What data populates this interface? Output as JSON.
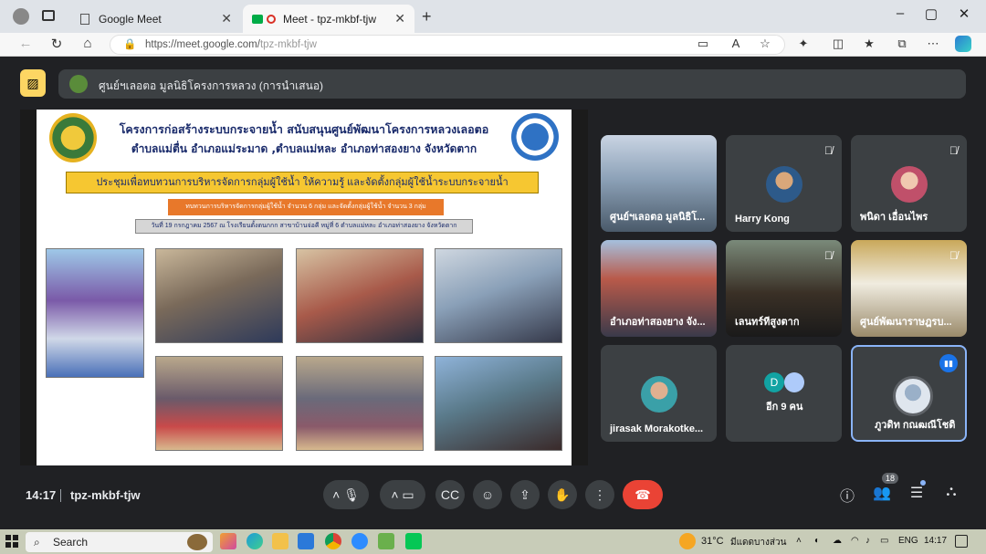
{
  "browser": {
    "tabs": [
      {
        "title": "Google Meet"
      },
      {
        "title": "Meet - tpz-mkbf-tjw"
      }
    ],
    "url_prefix": "https://meet.google.com/",
    "url_path": "tpz-mkbf-tjw"
  },
  "meet": {
    "presenter_banner": "ศูนย์ฯเลอตอ มูลนิธิโครงการหลวง (การนำเสนอ)",
    "slide": {
      "title_line1": "โครงการก่อสร้างระบบกระจายน้ำ สนับสนุนศูนย์พัฒนาโครงการหลวงเลอตอ",
      "title_line2": "ตำบลแม่ตื่น อำเภอแม่ระมาด ,ตำบลแม่หละ อำเภอท่าสองยาง จังหวัดตาก",
      "yellow_heading": "ประชุมเพื่อทบทวนการบริหารจัดการกลุ่มผู้ใช้น้ำ ให้ความรู้ และจัดตั้งกลุ่มผู้ใช้น้ำระบบกระจายน้ำ",
      "orange_text": "ทบทวนการบริหารจัดการกลุ่มผู้ใช้น้ำ จำนวน 6 กลุ่ม และจัดตั้งกลุ่มผู้ใช้น้ำ จำนวน 3 กลุ่ม",
      "grey_text": "วันที่ 19 กรกฎาคม 2567 ณ โรงเรียนตั้งตนกกก สาขาบ้านจ่อคี หมู่ที่ 6 ตำบลแม่หละ อำเภอท่าสองยาง จังหวัดตาก"
    },
    "participants": [
      {
        "name": "ศูนย์ฯเลอตอ มูลนิธิโ...",
        "muted": false,
        "avatar_icon": "room-video"
      },
      {
        "name": "Harry Kong",
        "muted": true,
        "avatar_icon": "avatar-photo"
      },
      {
        "name": "พนิดา เอื่อนไพร",
        "muted": true,
        "avatar_icon": "avatar-photo"
      },
      {
        "name": "อำเภอท่าสองยาง จัง...",
        "muted": false,
        "avatar_icon": "room-video"
      },
      {
        "name": "เลนทร์ทีสูงตาก",
        "muted": true,
        "avatar_icon": "person-video"
      },
      {
        "name": "ศูนย์พัฒนาราษฎรบ...",
        "muted": true,
        "avatar_icon": "room-video"
      },
      {
        "name": "jirasak Morakotke...",
        "muted": true,
        "avatar_icon": "avatar-photo"
      },
      {
        "name": "อีก 9 คน",
        "muted": false,
        "avatar_icon": "others-group"
      },
      {
        "name": "ภูวดิท กณฒณีโชติ",
        "muted": false,
        "avatar_icon": "avatar-photo",
        "speaking": true
      }
    ],
    "others_initial": "D",
    "time": "14:17",
    "meeting_code": "tpz-mkbf-tjw",
    "participant_count": "18"
  },
  "taskbar": {
    "search_label": "Search",
    "weather": "31°C",
    "weather_desc": "มีแดดบางส่วน",
    "lang": "ENG",
    "clock": "14:17"
  },
  "colors": {
    "meet_bg": "#202124",
    "tile_bg": "#3c4043",
    "end_call": "#ea4335",
    "present_stop": "#fdd663",
    "speaking_border": "#8ab4f8"
  }
}
